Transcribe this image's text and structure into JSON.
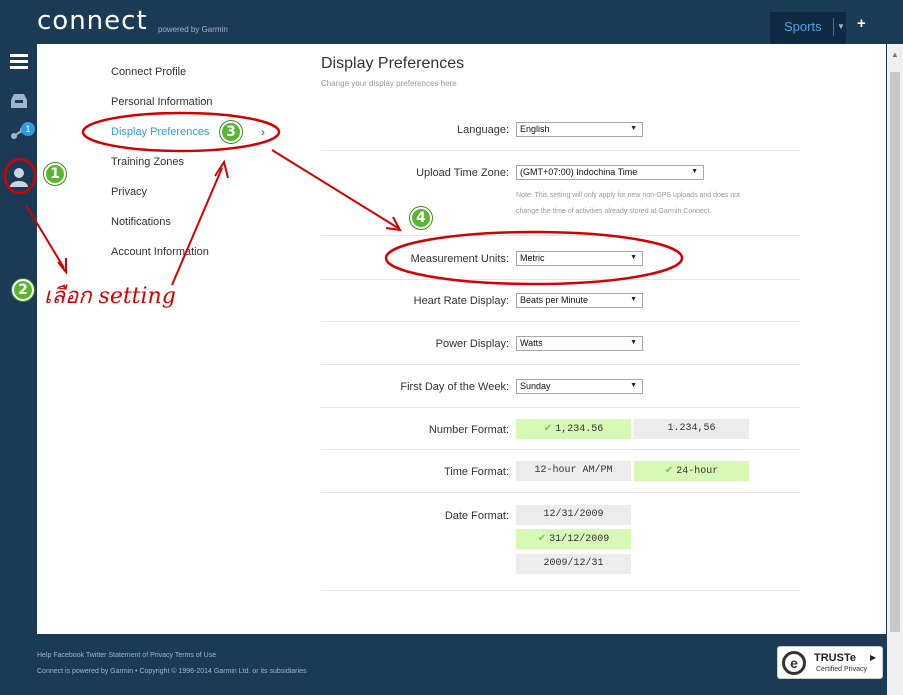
{
  "topbar": {
    "logo": "connect",
    "logo_sub": "powered by Garmin",
    "sports_label": "Sports",
    "plus_label": "+"
  },
  "leftnav": {
    "notification_count": "1"
  },
  "settings_menu": {
    "items": [
      {
        "label": "Connect Profile"
      },
      {
        "label": "Personal Information"
      },
      {
        "label": "Display Preferences"
      },
      {
        "label": "Training Zones"
      },
      {
        "label": "Privacy"
      },
      {
        "label": "Notifications"
      },
      {
        "label": "Account Information"
      }
    ],
    "chevron": "›"
  },
  "content": {
    "title": "Display Preferences",
    "subtitle": "Change your display preferences here",
    "language": {
      "label": "Language:",
      "value": "English"
    },
    "timezone": {
      "label": "Upload Time Zone:",
      "value": "(GMT+07:00) Indochina Time",
      "note_line1": "Note: This setting will only apply for new non-GPS uploads and does not",
      "note_line2": "change the time of activities already stored at Garmin Connect."
    },
    "units": {
      "label": "Measurement Units:",
      "value": "Metric"
    },
    "heart_rate": {
      "label": "Heart Rate Display:",
      "value": "Beats per Minute"
    },
    "power": {
      "label": "Power Display:",
      "value": "Watts"
    },
    "first_day": {
      "label": "First Day of the Week:",
      "value": "Sunday"
    },
    "number_format": {
      "label": "Number Format:",
      "options": [
        {
          "text": "1,234.56",
          "selected": true
        },
        {
          "text": "1.234,56",
          "selected": false
        }
      ]
    },
    "time_format": {
      "label": "Time Format:",
      "options": [
        {
          "text": "12-hour AM/PM",
          "selected": false
        },
        {
          "text": "24-hour",
          "selected": true
        }
      ]
    },
    "date_format": {
      "label": "Date Format:",
      "options": [
        {
          "text": "12/31/2009",
          "selected": false
        },
        {
          "text": "31/12/2009",
          "selected": true
        },
        {
          "text": "2009/12/31",
          "selected": false
        }
      ]
    }
  },
  "footer": {
    "links": [
      "Help",
      "Facebook",
      "Twitter",
      "Statement of Privacy",
      "Terms of Use"
    ],
    "links_text": "Help Facebook Twitter Statement of Privacy Terms of Use",
    "copyright": "Connect is powered by Garmin • Copyright © 1996-2014 Garmin Ltd. or its subsidiaries",
    "truste_name": "TRUSTe",
    "truste_tag": "Certified Privacy",
    "truste_e": "e"
  },
  "annotations": {
    "badges": [
      "1",
      "2",
      "3",
      "4"
    ],
    "handwriting": "เลือก setting",
    "ink_color": "#d60000",
    "badge_color": "#5cb531"
  },
  "colors": {
    "nav_bg": "#1b3a55",
    "accent": "#2f9be0",
    "selected_option": "#d7f9b6"
  }
}
